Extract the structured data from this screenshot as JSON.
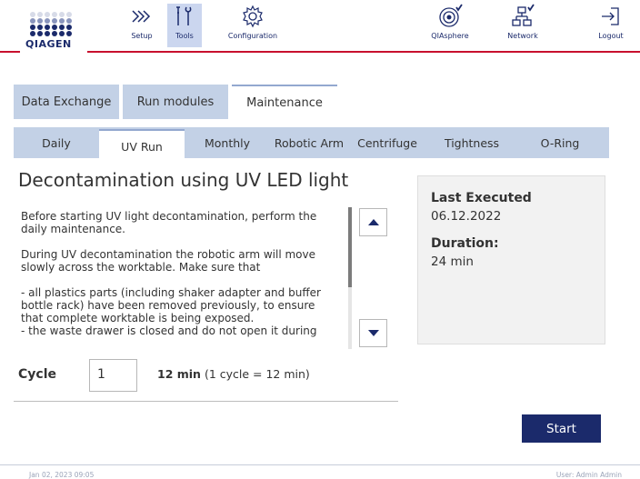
{
  "brand": {
    "logo_text": "QIAGEN"
  },
  "topnav": {
    "items": [
      {
        "label": "Setup",
        "icon": "chevrons-icon",
        "active": false
      },
      {
        "label": "Tools",
        "icon": "tools-icon",
        "active": true
      },
      {
        "label": "Configuration",
        "icon": "gear-icon",
        "active": false
      },
      {
        "label": "QIAsphere",
        "icon": "qiasphere-icon",
        "active": false
      },
      {
        "label": "Network",
        "icon": "network-icon",
        "active": false
      },
      {
        "label": "Logout",
        "icon": "logout-icon",
        "active": false
      }
    ]
  },
  "main_tabs": [
    {
      "label": "Data Exchange",
      "active": false
    },
    {
      "label": "Run modules",
      "active": false
    },
    {
      "label": "Maintenance",
      "active": true
    }
  ],
  "sub_tabs": [
    {
      "label": "Daily",
      "active": false
    },
    {
      "label": "UV Run",
      "active": true
    },
    {
      "label": "Monthly",
      "active": false
    },
    {
      "label": "Robotic Arm",
      "active": false
    },
    {
      "label": "Centrifuge",
      "active": false
    },
    {
      "label": "Tightness",
      "active": false
    },
    {
      "label": "O-Ring",
      "active": false
    }
  ],
  "content": {
    "title": "Decontamination using UV LED light",
    "para1": "Before starting UV light decontamination, perform the daily maintenance.",
    "para2": "During UV decontamination the robotic arm will move slowly across the worktable. Make sure that",
    "para3": "- all plastics parts (including shaker adapter and buffer bottle rack) have been removed previously, to ensure that complete worktable is being exposed.",
    "para4": "- the waste drawer is closed and do not open it during"
  },
  "info": {
    "last_executed_label": "Last Executed",
    "last_executed_value": "06.12.2022",
    "duration_label": "Duration:",
    "duration_value": "24 min"
  },
  "cycle": {
    "label": "Cycle",
    "value": "1",
    "time_bold": "12 min",
    "time_note": "(1 cycle = 12 min)"
  },
  "start_label": "Start",
  "footer": {
    "datetime": "Jan 02, 2023 09:05",
    "user": "User: Admin Admin"
  },
  "colors": {
    "navy": "#1b2a6b",
    "tab_blue": "#c3d1e6",
    "brand_red": "#c8102e"
  },
  "scroll_position": 0
}
